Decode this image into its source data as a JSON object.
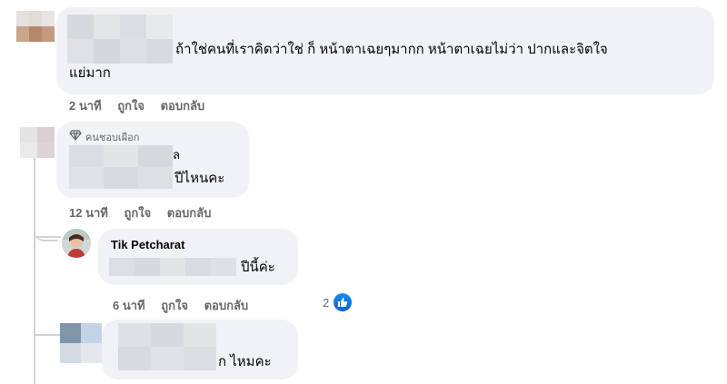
{
  "comments": [
    {
      "text": "ถ้าใช่คนที่เราคิดว่าใช่ ก็ หน้าตาเฉยๆมากก หน้าตาเฉยไม่ว่า ปากและจิตใจ",
      "text_line2": "แย่มาก",
      "time": "2 นาที",
      "like": "ถูกใจ",
      "reply": "ตอบกลับ"
    },
    {
      "badge": "คนชอบเผือก",
      "text_fragment": "ล",
      "text": "ปีไหนคะ",
      "time": "12 นาที",
      "like": "ถูกใจ",
      "reply": "ตอบกลับ"
    },
    {
      "author": "Tik Petcharat",
      "text": "ปีนี้ค่ะ",
      "time": "6 นาที",
      "like": "ถูกใจ",
      "reply": "ตอบกลับ",
      "reaction_count": "2"
    },
    {
      "text": "ก ไหมคะ"
    }
  ],
  "colors": {
    "bubble": "#f0f2f5",
    "meta": "#65676b",
    "like": "#1877f2"
  }
}
